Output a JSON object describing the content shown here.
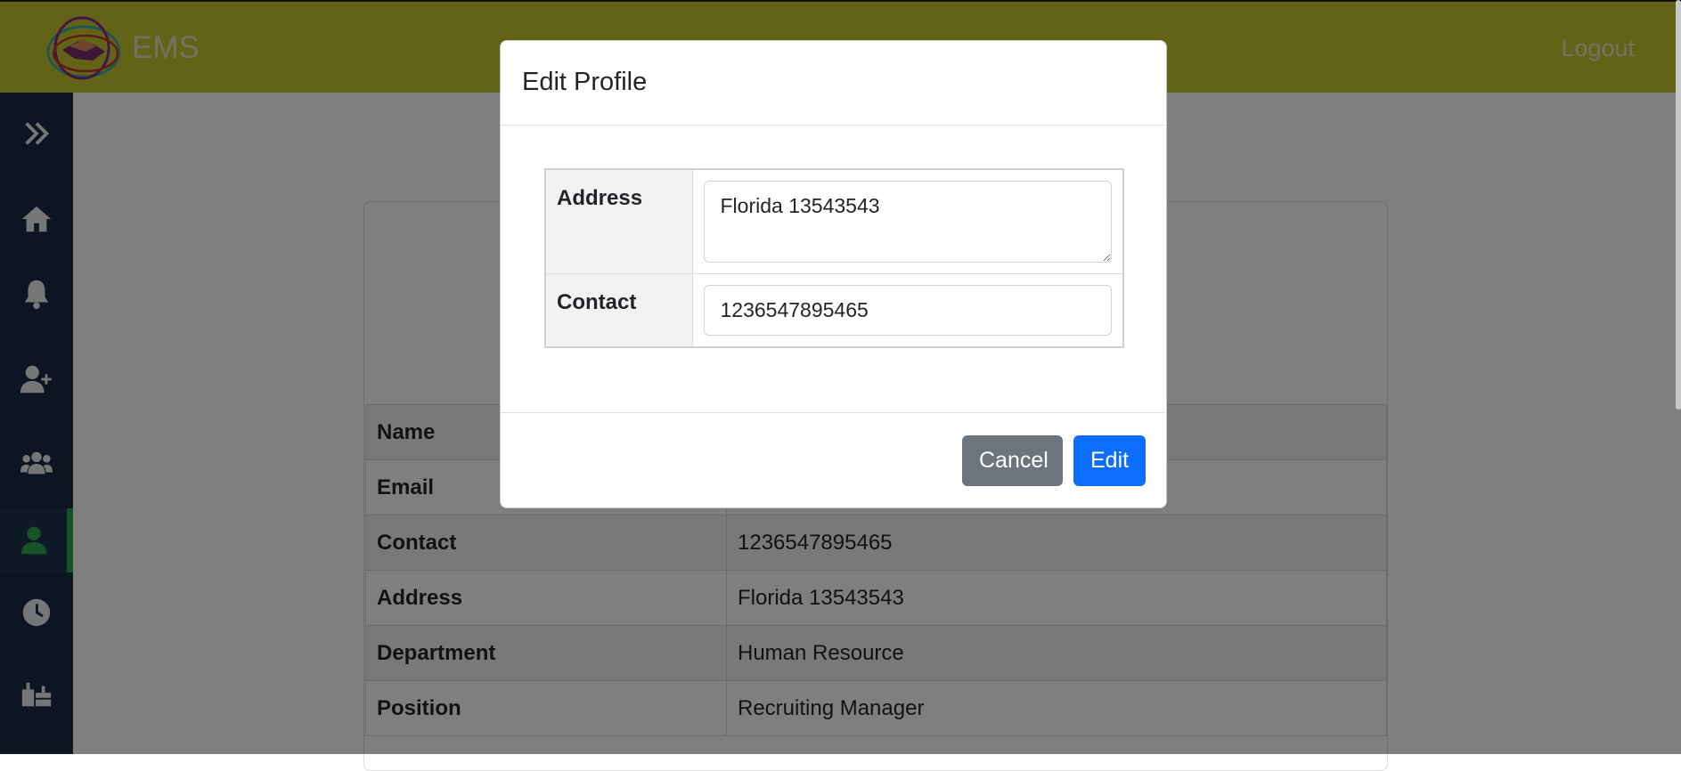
{
  "header": {
    "brand": "EMS",
    "logout": "Logout"
  },
  "sidebar": {
    "items": [
      {
        "icon": "double-chevron-right-icon"
      },
      {
        "icon": "home-icon"
      },
      {
        "icon": "bell-icon"
      },
      {
        "icon": "user-plus-icon"
      },
      {
        "icon": "users-icon"
      },
      {
        "icon": "user-icon",
        "active": true
      },
      {
        "icon": "clock-icon"
      },
      {
        "icon": "gift-icon"
      }
    ]
  },
  "profile": {
    "rows": [
      {
        "label": "Name",
        "value": ""
      },
      {
        "label": "Email",
        "value": ""
      },
      {
        "label": "Contact",
        "value": "1236547895465"
      },
      {
        "label": "Address",
        "value": "Florida 13543543"
      },
      {
        "label": "Department",
        "value": "Human Resource"
      },
      {
        "label": "Position",
        "value": "Recruiting Manager"
      }
    ]
  },
  "modal": {
    "title": "Edit Profile",
    "address_label": "Address",
    "address_value": "Florida 13543543",
    "contact_label": "Contact",
    "contact_value": "1236547895465",
    "cancel_label": "Cancel",
    "edit_label": "Edit"
  },
  "colors": {
    "topbar": "#c6c631",
    "sidebar": "#1a2a45",
    "active_accent": "#2ea84a",
    "cancel_button": "#6c757d",
    "edit_button": "#0d6efd"
  }
}
